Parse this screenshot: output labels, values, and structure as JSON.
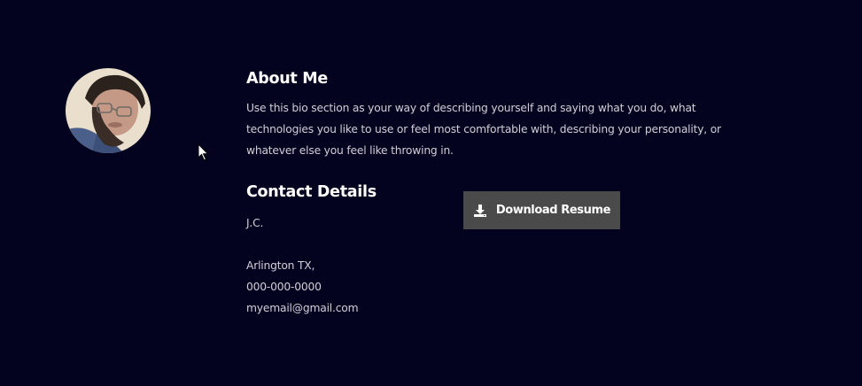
{
  "about": {
    "title": "About Me",
    "bio": "Use this bio section as your way of describing yourself and saying what you do, what technologies you like to use or feel most comfortable with, describing your personality, or whatever else you feel like throwing in."
  },
  "contact": {
    "title": "Contact Details",
    "name": "J.C.",
    "location": "Arlington TX,",
    "phone": "000-000-0000",
    "email": "myemail@gmail.com"
  },
  "download": {
    "label": "Download Resume",
    "icon": "download-icon"
  },
  "profile": {
    "avatar_icon": "profile-photo"
  },
  "colors": {
    "background": "#03031f",
    "button": "#4a4a4a",
    "heading": "#ffffff",
    "body_text": "#cfcfd8"
  }
}
